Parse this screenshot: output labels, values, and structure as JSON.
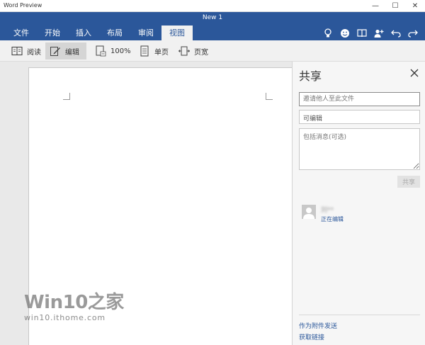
{
  "window": {
    "app_title": "Word Preview",
    "doc_title": "New 1",
    "controls": {
      "minimize": "—",
      "maximize": "☐",
      "close": "✕"
    }
  },
  "ribbon": {
    "tabs": [
      {
        "label": "文件"
      },
      {
        "label": "开始"
      },
      {
        "label": "插入"
      },
      {
        "label": "布局"
      },
      {
        "label": "审阅"
      },
      {
        "label": "视图",
        "active": true
      }
    ],
    "icons": [
      "lightbulb-icon",
      "smiley-icon",
      "book-icon",
      "share-person-icon",
      "undo-icon",
      "redo-icon"
    ],
    "color": "#2b579a"
  },
  "toolbar": {
    "read": "阅读",
    "edit": "编辑",
    "zoom": "100%",
    "single_page": "单页",
    "page_width": "页宽"
  },
  "watermark": {
    "logo": "Win10之家",
    "url": "win10.ithome.com"
  },
  "share_panel": {
    "title": "共享",
    "invite_placeholder": "邀请他人至此文件",
    "permission": "可编辑",
    "message_placeholder": "包括消息(可选)",
    "share_button": "共享",
    "person": {
      "name": "刘**",
      "status": "正在编辑"
    },
    "send_as_attachment": "作为附件发送",
    "get_link": "获取链接"
  }
}
